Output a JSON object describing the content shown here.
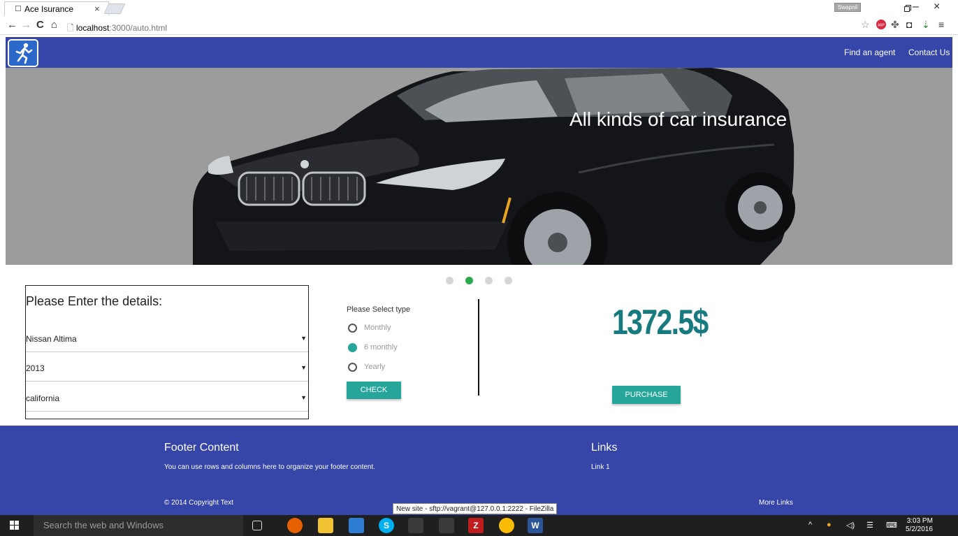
{
  "browser": {
    "tab_title": "Ace Isurance",
    "tab_close": "×",
    "profile_name": "Swapnil",
    "url_host": "localhost",
    "url_path": ":3000/auto.html",
    "window_minimize": "–",
    "window_restore": "▫",
    "window_close": "×"
  },
  "navbar": {
    "links": [
      "Find an agent",
      "Contact Us"
    ],
    "color": "#3545a8"
  },
  "hero": {
    "caption": "All kinds of car insurance",
    "slide_count": 4,
    "active_slide": 1
  },
  "form": {
    "title": "Please Enter the details:",
    "car_model": "Nissan Altima",
    "year": "2013",
    "state": "california"
  },
  "plan": {
    "label": "Please Select type",
    "options": [
      "Monthly",
      "6 monthly",
      "Yearly"
    ],
    "selected": 1,
    "check_label": "CHECK"
  },
  "quote": {
    "price": "1372.5$",
    "purchase_label": "PURCHASE",
    "accent": "#26a69a"
  },
  "footer": {
    "title": "Footer Content",
    "text": "You can use rows and columns here to organize your footer content.",
    "links_title": "Links",
    "link1": "Link 1",
    "copyright": "© 2014 Copyright Text",
    "more_links": "More Links"
  },
  "tooltip": "New site - sftp://vagrant@127.0.0.1:2222 - FileZilla",
  "taskbar": {
    "search_placeholder": "Search the web and Windows",
    "time": "3:03 PM",
    "date": "5/2/2016"
  }
}
